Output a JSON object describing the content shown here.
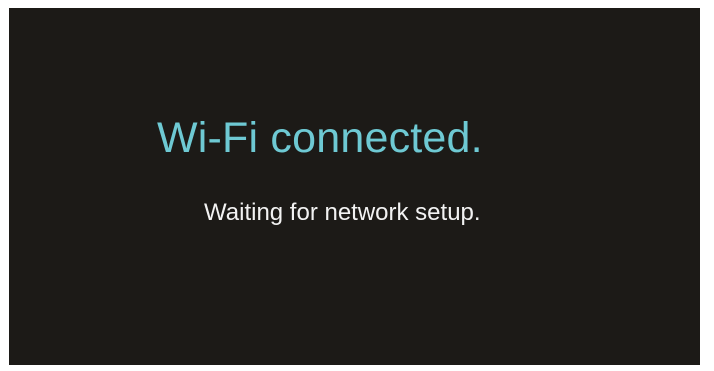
{
  "screen": {
    "title": "Wi-Fi connected.",
    "message": "Waiting for network setup."
  },
  "colors": {
    "background": "#1c1a17",
    "title": "#6ec9d3",
    "message": "#f2f2f2"
  }
}
